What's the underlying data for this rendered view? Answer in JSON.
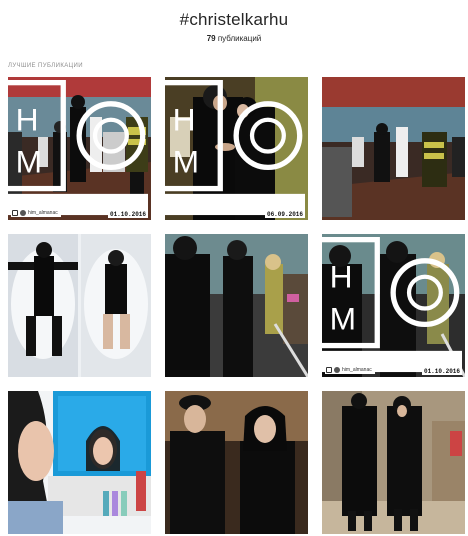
{
  "header": {
    "hashtag": "#christelkarhu",
    "count_number": "79",
    "count_label": "публикаций"
  },
  "section": {
    "label": "ЛУЧШИЕ ПУБЛИКАЦИИ"
  },
  "posts": [
    {
      "name": "post-1",
      "badge_name": "him_almanac",
      "date": "01.10.2016",
      "logo": true
    },
    {
      "name": "post-2",
      "badge_name": "",
      "date": "06.09.2016",
      "logo": true
    },
    {
      "name": "post-3",
      "badge_name": "",
      "date": "",
      "logo": false
    },
    {
      "name": "post-4",
      "badge_name": "",
      "date": "",
      "logo": false
    },
    {
      "name": "post-5",
      "badge_name": "",
      "date": "",
      "logo": false
    },
    {
      "name": "post-6",
      "badge_name": "him_almanac",
      "date": "01.10.2016",
      "logo": true
    },
    {
      "name": "post-7",
      "badge_name": "",
      "date": "",
      "logo": false
    },
    {
      "name": "post-8",
      "badge_name": "",
      "date": "",
      "logo": false
    },
    {
      "name": "post-9",
      "badge_name": "",
      "date": "",
      "logo": false
    }
  ]
}
